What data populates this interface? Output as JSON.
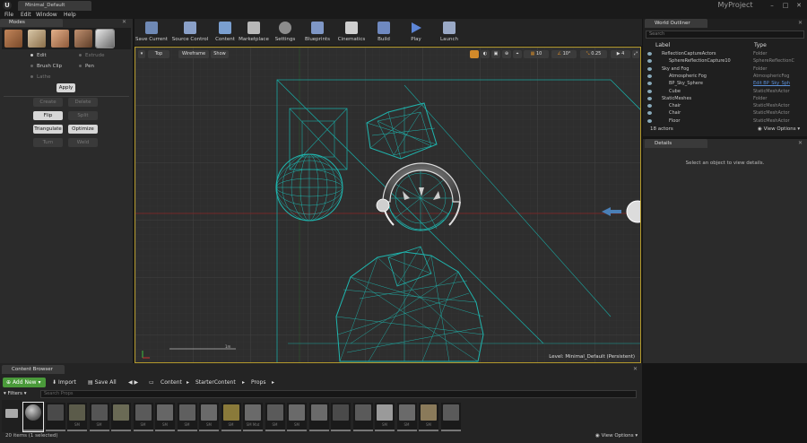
{
  "window": {
    "doc_tab": "Minimal_Default",
    "project_name": "MyProject",
    "minimize": "–",
    "maximize": "□",
    "close": "✕"
  },
  "menu": [
    "File",
    "Edit",
    "Window",
    "Help"
  ],
  "modes": {
    "tab_label": "Modes",
    "options": [
      {
        "label": "Edit",
        "selected": true
      },
      {
        "label": "Extrude",
        "selected": false
      },
      {
        "label": "Brush Clip",
        "selected": false
      },
      {
        "label": "Pen",
        "selected": false
      },
      {
        "label": "Lathe",
        "selected": false
      }
    ],
    "apply_label": "Apply",
    "geometry_buttons": [
      {
        "label": "Create",
        "active": false
      },
      {
        "label": "Delete",
        "active": false
      },
      {
        "label": "Flip",
        "active": true
      },
      {
        "label": "Split",
        "active": false
      },
      {
        "label": "Triangulate",
        "active": true
      },
      {
        "label": "Optimize",
        "active": true
      },
      {
        "label": "Turn",
        "active": false
      },
      {
        "label": "Weld",
        "active": false
      }
    ]
  },
  "toolbar": {
    "buttons": [
      {
        "label": "Save Current",
        "icon": "save-icon",
        "color": "#6f89b5"
      },
      {
        "label": "Source Control",
        "icon": "source-control-icon",
        "color": "#8aa0c8"
      },
      {
        "label": "Content",
        "icon": "content-icon",
        "color": "#7a9fd0"
      },
      {
        "label": "Marketplace",
        "icon": "marketplace-icon",
        "color": "#b8b8b8"
      },
      {
        "label": "Settings",
        "icon": "settings-icon",
        "color": "#8c8c8c"
      },
      {
        "label": "Blueprints",
        "icon": "blueprints-icon",
        "color": "#7f97c6"
      },
      {
        "label": "Cinematics",
        "icon": "cinematics-icon",
        "color": "#cfcfcf"
      },
      {
        "label": "Build",
        "icon": "build-icon",
        "color": "#6f89c0"
      },
      {
        "label": "Play",
        "icon": "play-icon",
        "color": "#5d86d6"
      },
      {
        "label": "Launch",
        "icon": "launch-icon",
        "color": "#9aa9c6"
      }
    ]
  },
  "viewport": {
    "view_label": "Top",
    "mode_label": "Wireframe",
    "show_label": "Show",
    "grid_snap": "10",
    "rotation_snap": "10°",
    "scale_snap": "0.25",
    "camera_speed": "4",
    "level_label": "Level:  Minimal_Default (Persistent)",
    "scale_bar_label": "1m"
  },
  "outliner": {
    "tab_label": "World Outliner",
    "search_placeholder": "Search",
    "col_label": "Label",
    "col_type": "Type",
    "rows": [
      {
        "label": "ReflectionCaptureActors",
        "type": "Folder",
        "indent": 1,
        "kind": "folder"
      },
      {
        "label": "SphereReflectionCapture10",
        "type": "SphereReflectionC",
        "indent": 2,
        "kind": "actor"
      },
      {
        "label": "Sky and Fog",
        "type": "Folder",
        "indent": 1,
        "kind": "folder"
      },
      {
        "label": "Atmospheric Fog",
        "type": "AtmosphericFog",
        "indent": 2,
        "kind": "actor"
      },
      {
        "label": "BP_Sky_Sphere",
        "type": "Edit BP_Sky_Sph",
        "indent": 2,
        "kind": "actor"
      },
      {
        "label": "Cube",
        "type": "StaticMeshActor",
        "indent": 2,
        "kind": "actor"
      },
      {
        "label": "StaticMeshes",
        "type": "Folder",
        "indent": 1,
        "kind": "folder"
      },
      {
        "label": "Chair",
        "type": "StaticMeshActor",
        "indent": 2,
        "kind": "actor"
      },
      {
        "label": "Chair",
        "type": "StaticMeshActor",
        "indent": 2,
        "kind": "actor"
      },
      {
        "label": "Floor",
        "type": "StaticMeshActor",
        "indent": 2,
        "kind": "actor"
      }
    ],
    "actor_count": "18 actors",
    "view_options": "View Options"
  },
  "details": {
    "tab_label": "Details",
    "empty_message": "Select an object to view details."
  },
  "content_browser": {
    "tab_label": "Content Browser",
    "add_new": "Add New",
    "import": "Import",
    "save_all": "Save All",
    "breadcrumbs": [
      "Content",
      "StarterContent",
      "Props"
    ],
    "filters_label": "Filters",
    "search_placeholder": "Search Props",
    "asset_labels": [
      "",
      "",
      "SM",
      "SM",
      "",
      "SM",
      "SM",
      "SM",
      "SM",
      "SM",
      "SM Mat",
      "SM",
      "SM",
      "",
      "",
      "",
      "SM",
      "SM",
      "SM",
      ""
    ],
    "status": "20 items (1 selected)",
    "view_options": "View Options"
  }
}
